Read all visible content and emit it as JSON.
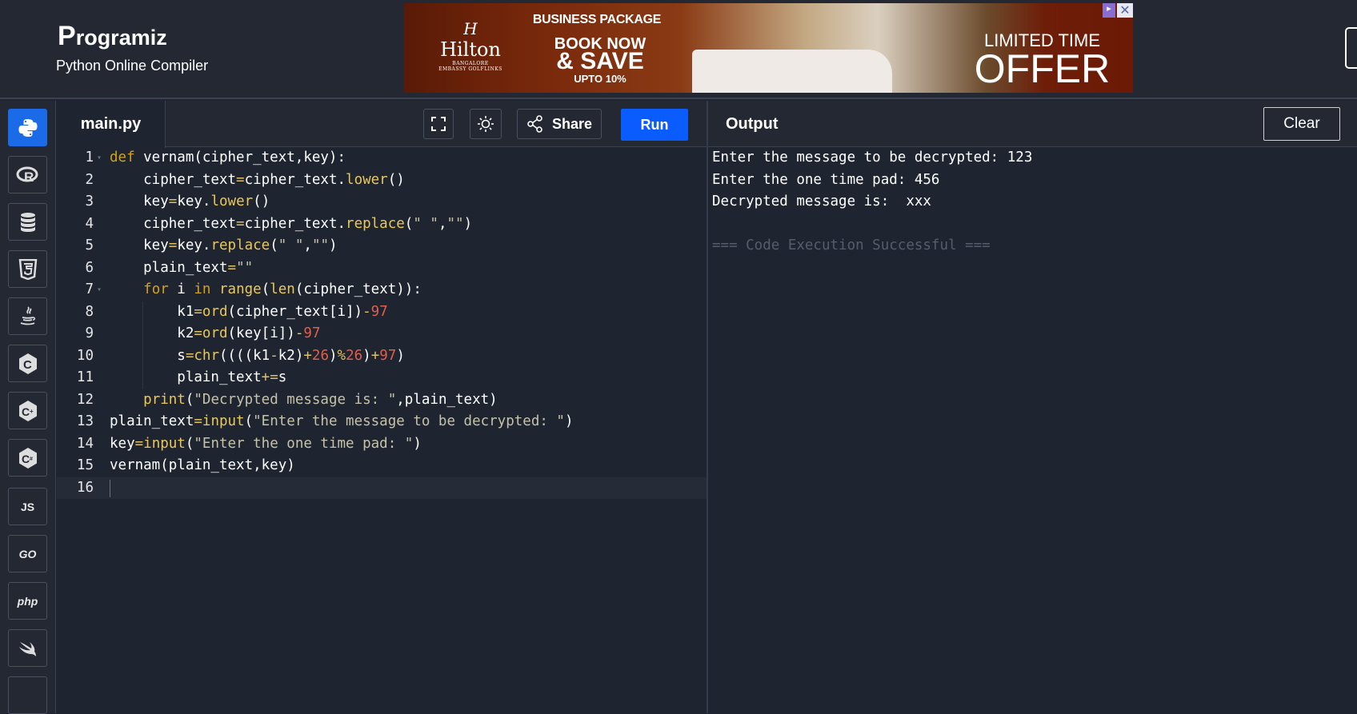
{
  "header": {
    "logo_text": "rogramiz",
    "logo_initial": "P",
    "subtitle": "Python Online Compiler"
  },
  "ad": {
    "hotel_logo": "H",
    "hotel_name": "Hilton",
    "hotel_location_line1": "BANGALORE",
    "hotel_location_line2": "EMBASSY GOLFLINKS",
    "package": "BUSINESS PACKAGE",
    "book_now": "BOOK NOW",
    "save": "& SAVE",
    "upto": "UPTO 10%",
    "limited": "LIMITED TIME",
    "offer": "OFFER",
    "choices_icon": "ad-choices-icon",
    "close_icon": "close-icon"
  },
  "sidebar": {
    "items": [
      {
        "name": "python",
        "label": "",
        "icon": "python-icon",
        "active": true
      },
      {
        "name": "r",
        "label": "R",
        "icon": "r-icon"
      },
      {
        "name": "sql",
        "label": "",
        "icon": "database-icon"
      },
      {
        "name": "html",
        "label": "5",
        "icon": "html5-icon"
      },
      {
        "name": "java",
        "label": "",
        "icon": "java-icon"
      },
      {
        "name": "c",
        "label": "C",
        "icon": "c-icon"
      },
      {
        "name": "cpp",
        "label": "C+",
        "icon": "cpp-icon"
      },
      {
        "name": "csharp",
        "label": "C#",
        "icon": "csharp-icon"
      },
      {
        "name": "js",
        "label": "JS",
        "icon": "js-icon"
      },
      {
        "name": "go",
        "label": "GO",
        "icon": "go-icon"
      },
      {
        "name": "php",
        "label": "php",
        "icon": "php-icon"
      },
      {
        "name": "swift",
        "label": "",
        "icon": "swift-icon"
      }
    ]
  },
  "editor": {
    "filename": "main.py",
    "fullscreen_icon": "fullscreen-icon",
    "theme_icon": "sun-icon",
    "share_label": "Share",
    "share_icon": "share-icon",
    "run_label": "Run",
    "line_numbers": [
      "1",
      "2",
      "3",
      "4",
      "5",
      "6",
      "7",
      "8",
      "9",
      "10",
      "11",
      "12",
      "13",
      "14",
      "15",
      "16"
    ],
    "code_lines": [
      "def vernam(cipher_text,key):",
      "    cipher_text=cipher_text.lower()",
      "    key=key.lower()",
      "    cipher_text=cipher_text.replace(\" \",\"\")",
      "    key=key.replace(\" \",\"\")",
      "    plain_text=\"\"",
      "    for i in range(len(cipher_text)):",
      "        k1=ord(cipher_text[i])-97",
      "        k2=ord(key[i])-97",
      "        s=chr((((k1-k2)+26)%26)+97)",
      "        plain_text+=s",
      "    print(\"Decrypted message is: \",plain_text)",
      "plain_text=input(\"Enter the message to be decrypted: \")",
      "key=input(\"Enter the one time pad: \")",
      "vernam(plain_text,key)",
      ""
    ]
  },
  "output": {
    "title": "Output",
    "clear_label": "Clear",
    "lines": [
      "Enter the message to be decrypted: 123",
      "Enter the one time pad: 456",
      "Decrypted message is:  xxx",
      "",
      "=== Code Execution Successful ==="
    ]
  }
}
